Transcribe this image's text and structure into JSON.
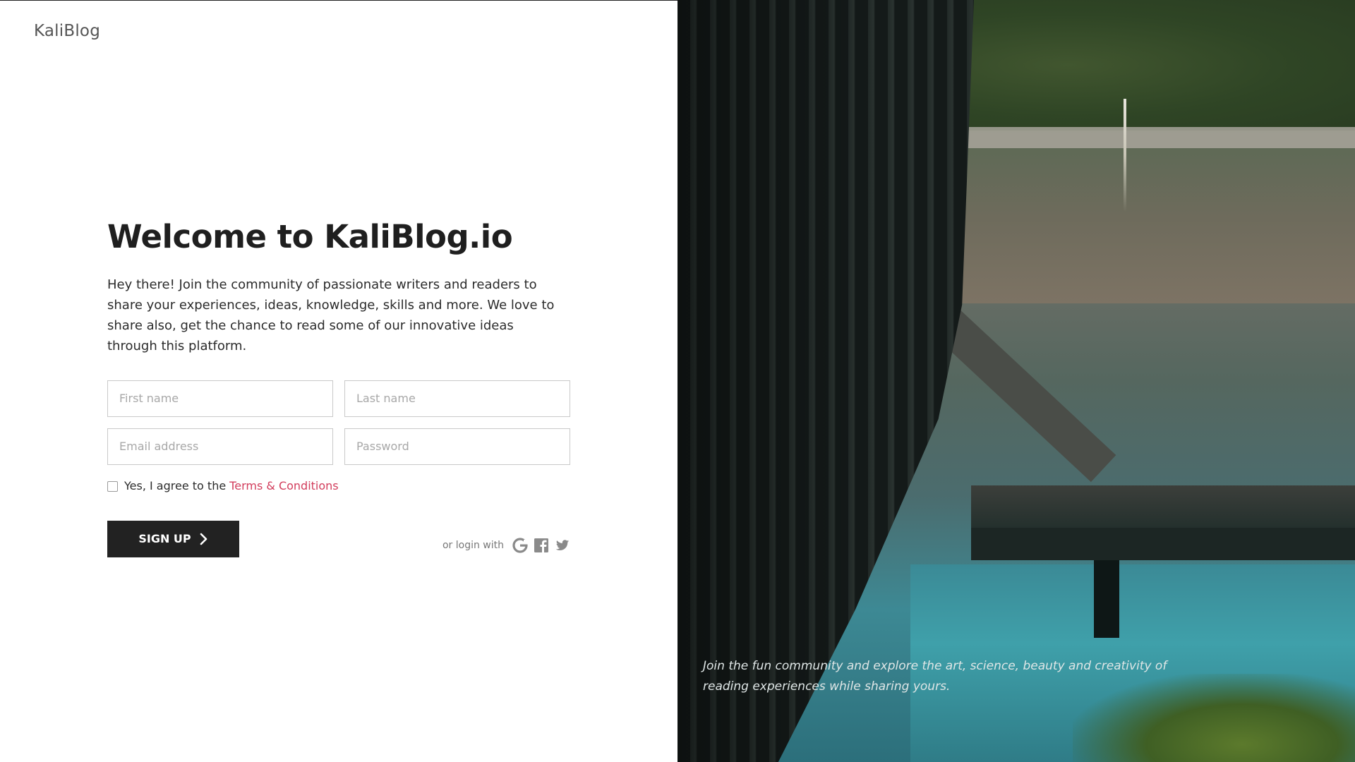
{
  "brand": {
    "name": "KaliBlog"
  },
  "hero": {
    "title": "Welcome to KaliBlog.io",
    "intro": "Hey there! Join the community of passionate writers and readers to share your experiences, ideas, knowledge, skills and more. We love to share also, get the chance to read some of our innovative ideas through this platform."
  },
  "form": {
    "first_name": {
      "placeholder": "First name",
      "value": ""
    },
    "last_name": {
      "placeholder": "Last name",
      "value": ""
    },
    "email": {
      "placeholder": "Email address",
      "value": ""
    },
    "password": {
      "placeholder": "Password",
      "value": ""
    },
    "agree_text": "Yes, I agree to the",
    "terms_link": "Terms & Conditions",
    "agree_checked": false,
    "signup_label": "SIGN UP"
  },
  "social": {
    "label": "or login with",
    "providers": [
      {
        "name": "google",
        "icon": "google-icon"
      },
      {
        "name": "facebook",
        "icon": "facebook-icon"
      },
      {
        "name": "twitter",
        "icon": "twitter-icon"
      }
    ]
  },
  "image_panel": {
    "caption": "Join the fun community and explore the art, science, beauty and creativity of reading experiences while sharing yours."
  },
  "colors": {
    "accent_link": "#d23d5c",
    "button_bg": "#222222",
    "text_primary": "#1f1f1f"
  }
}
